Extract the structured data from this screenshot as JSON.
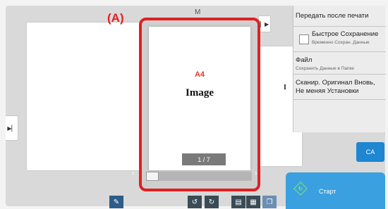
{
  "callout": {
    "label": "(A)"
  },
  "preview": {
    "paper_size": "A4",
    "content_label": "Image",
    "page_counter": "1 / 7",
    "scroll_position": 0
  },
  "background": {
    "glyph_right": "I",
    "glyph_top": "M"
  },
  "action_panel": {
    "send_after_print": "Передать после печати",
    "quick_save": {
      "title": "Быстрое Сохранение",
      "subtitle": "Временно Сохран. Данные"
    },
    "file": {
      "title": "Файл",
      "subtitle": "Сохранить Данные в Папке"
    },
    "rescan": "Сканир. Оригинал Вновь, Не меняя Установки"
  },
  "buttons": {
    "ca": "CA",
    "start": "Старт"
  },
  "icons": {
    "side_left": "expand-right-icon",
    "side_right": "expand-right-icon",
    "edit": "edit-icon",
    "rotate_left": "rotate-left-icon",
    "rotate_right": "rotate-right-icon",
    "view_single": "single-page-view-icon",
    "view_grid": "grid-view-icon",
    "view_stack": "stack-view-icon",
    "start": "start-diamond-icon"
  },
  "colors": {
    "highlight": "#e02020",
    "accent": "#1f86d1",
    "start": "#3aa0e0",
    "paper_size_text": "#e03a2a"
  }
}
